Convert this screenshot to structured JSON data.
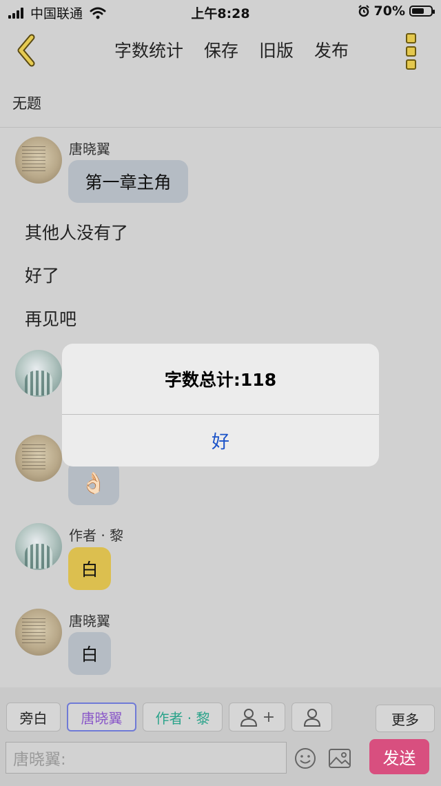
{
  "status_bar": {
    "carrier": "中国联通",
    "time": "上午8:28",
    "battery": "70%",
    "battery_level": 0.7
  },
  "nav": {
    "items": [
      "字数统计",
      "保存",
      "旧版",
      "发布"
    ]
  },
  "title": "无题",
  "messages": [
    {
      "sender": "唐晓翼",
      "text": "第一章主角"
    },
    {
      "text": "其他人没有了"
    },
    {
      "text": "好了"
    },
    {
      "text": "再见吧"
    },
    {
      "sender": "",
      "text": ""
    },
    {
      "sender": "",
      "text": "👌🏻"
    },
    {
      "sender": "作者 · 黎",
      "text": "白"
    },
    {
      "sender": "唐晓翼",
      "text": "白"
    }
  ],
  "dialog": {
    "message": "字数总计:118",
    "ok": "好"
  },
  "input_bar": {
    "roles": [
      "旁白",
      "唐晓翼",
      "作者 · 黎"
    ],
    "add_role": "+",
    "more": "更多",
    "placeholder": "唐晓翼:",
    "send": "发送"
  },
  "colors": {
    "background": "#d1d1d1",
    "author_bubble": "#dcbf4f",
    "character_bubble": "#b5bcc4",
    "send_button": "#d84f7f",
    "dialog_link": "#1a52c8"
  }
}
